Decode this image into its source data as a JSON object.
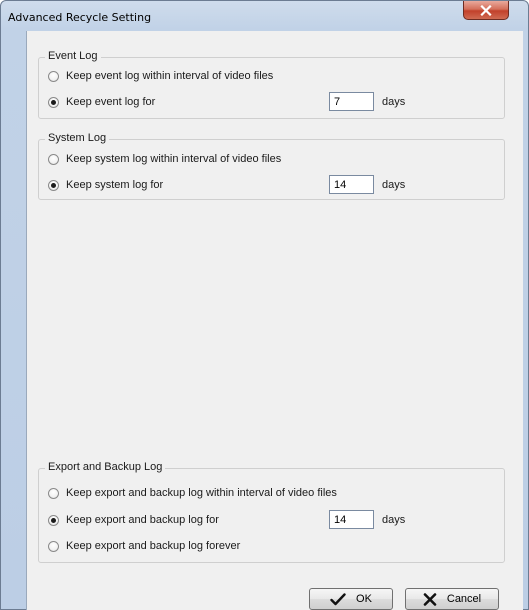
{
  "window": {
    "title": "Advanced Recycle Setting",
    "close_glyph": "X"
  },
  "event_log": {
    "legend": "Event Log",
    "option_interval": "Keep event log within interval of video files",
    "option_keep_for": "Keep event log for",
    "selected": "keep_for",
    "days_value": "7",
    "unit": "days"
  },
  "system_log": {
    "legend": "System Log",
    "option_interval": "Keep system log within interval of video files",
    "option_keep_for": "Keep system log for",
    "selected": "keep_for",
    "days_value": "14",
    "unit": "days"
  },
  "export_backup_log": {
    "legend": "Export and Backup Log",
    "option_interval": "Keep export and backup log within interval of video files",
    "option_keep_for": "Keep export and backup log for",
    "option_forever": "Keep export and backup log forever",
    "selected": "keep_for",
    "days_value": "14",
    "unit": "days"
  },
  "buttons": {
    "ok_label": "OK",
    "cancel_label": "Cancel",
    "ok_icon": "checkmark-icon",
    "cancel_icon": "x-icon"
  }
}
